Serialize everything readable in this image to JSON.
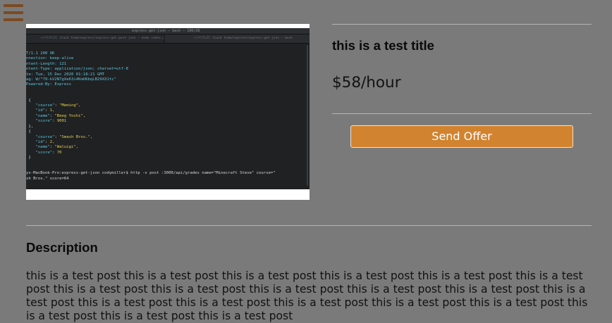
{
  "nav": {
    "menu_icon": "hamburger-menu-icon"
  },
  "listing": {
    "title": "this is a test title",
    "price": "$58/hour",
    "send_offer_label": "Send Offer",
    "colors": {
      "button": "#d2832f",
      "menu_icon": "#7b4a22",
      "background": "#7a7a7a"
    }
  },
  "description": {
    "heading": "Description",
    "body": "this is a test post this is a test post this is a test post this is a test post this is a test post this is a test post this is a test post this is a test post this is a test post this is a test post this is a test post this is a test post this is a test post this is a test post this is a test post this is a test post this is a test post this is a test post this is a test post this is a test post"
  },
  "screenshot": {
    "window_title": "express-get-json — bash — 106×38",
    "tab_left": "~/rf/full stack team/express/express-get-post-json — node index.js",
    "tab_right": "~/rf/full stack team/express/express-get-json — bash",
    "lines": [
      "T/1.1 200 OK",
      "nnection: keep-alive",
      "ntent-Length: 121",
      "ntent-Type: application/json; charset=utf-8",
      "te: Tue, 15 Dec 2020 01:18:21 GMT",
      "ag: W/\"79-kV2N7gXe63i4KmUKbqLB29XX1tc\"",
      "Powered-By: Express",
      "",
      "",
      " {",
      "    \"course\": \"Meming\",",
      "    \"id\": 1,",
      "    \"name\": \"Beeg Yoshi\",",
      "    \"score\": 9001",
      " },",
      " {",
      "    \"course\": \"Smash Bros.\",",
      "    \"id\": 2,",
      "    \"name\": \"Waluigi\",",
      "    \"score\": 70",
      " }",
      "",
      "",
      "ys-MacBook-Pro:express-get-json codymiller$ http -v post :3000/api/grades name=\"Minecraft Steve\" course=\"",
      "sh Bros.\" score=64"
    ]
  }
}
